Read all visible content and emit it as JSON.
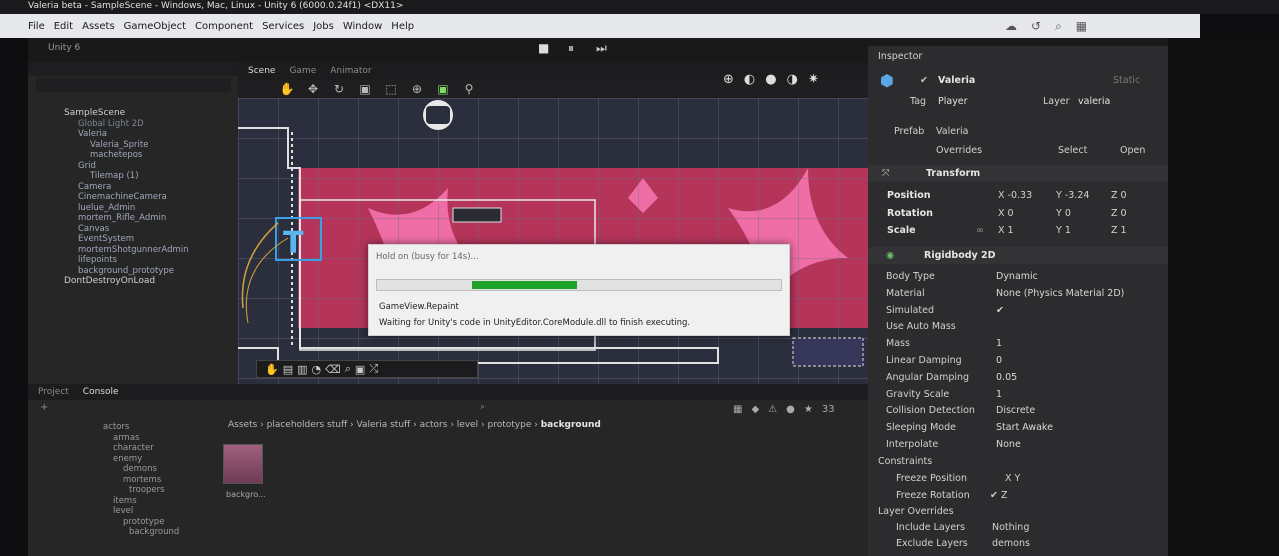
{
  "window": {
    "title": "Valeria beta - SampleScene - Windows, Mac, Linux - Unity 6 (6000.0.24f1) <DX11>"
  },
  "menu": [
    "File",
    "Edit",
    "Assets",
    "GameObject",
    "Component",
    "Services",
    "Jobs",
    "Window",
    "Help"
  ],
  "toolbar": {
    "account": "Unity 6",
    "play": "▶",
    "pause": "⏸",
    "step": "⏭"
  },
  "hierarchy": {
    "items": [
      {
        "label": "SampleScene",
        "kind": "scene"
      },
      {
        "label": "Global Light 2D",
        "kind": "dim"
      },
      {
        "label": "Valeria",
        "kind": "item"
      },
      {
        "label": "Valeria_Sprite",
        "kind": "item"
      },
      {
        "label": "machetepos",
        "kind": "item"
      },
      {
        "label": "Grid",
        "kind": "item"
      },
      {
        "label": "Tilemap (1)",
        "kind": "item"
      },
      {
        "label": "Camera",
        "kind": "item"
      },
      {
        "label": "CinemachineCamera",
        "kind": "item"
      },
      {
        "label": "luelue_Admin",
        "kind": "item"
      },
      {
        "label": "mortem_Rifle_Admin",
        "kind": "item"
      },
      {
        "label": "Canvas",
        "kind": "item"
      },
      {
        "label": "EventSystem",
        "kind": "item"
      },
      {
        "label": "mortemShotgunnerAdmin",
        "kind": "item"
      },
      {
        "label": "lifepoints",
        "kind": "item"
      },
      {
        "label": "background_prototype",
        "kind": "item"
      },
      {
        "label": "DontDestroyOnLoad",
        "kind": "scene"
      }
    ]
  },
  "scene_tabs": [
    "Scene",
    "Game",
    "Animator"
  ],
  "progress_dialog": {
    "title": "Hold on (busy for 14s)...",
    "step": "GameView.Repaint",
    "message": "Waiting for Unity's code in UnityEditor.CoreModule.dll to finish executing.",
    "progress": 0.26
  },
  "project": {
    "tabs": [
      "Project",
      "Console"
    ],
    "breadcrumb": [
      "Assets",
      "placeholders stuff",
      "Valeria stuff",
      "actors",
      "level",
      "prototype",
      "background"
    ],
    "tree": [
      "actors",
      "armas",
      "character",
      "enemy",
      "demons",
      "mortems",
      "troopers",
      "items",
      "level",
      "prototype",
      "background"
    ],
    "asset_label": "backgro...",
    "count": "33"
  },
  "inspector": {
    "title": "Inspector",
    "object_name": "Valeria",
    "static_label": "Static",
    "tag_label": "Tag",
    "tag": "Player",
    "layer_label": "Layer",
    "layer": "valeria",
    "prefab_label": "Prefab",
    "prefab": "Valeria",
    "overrides": "Overrides",
    "select": "Select",
    "open": "Open",
    "transform": {
      "header": "Transform",
      "position": {
        "label": "Position",
        "x": "X -0.33",
        "y": "Y -3.24",
        "z": "Z 0"
      },
      "rotation": {
        "label": "Rotation",
        "x": "X 0",
        "y": "Y 0",
        "z": "Z 0"
      },
      "scale": {
        "label": "Scale",
        "x": "X 1",
        "y": "Y 1",
        "z": "Z 1"
      }
    },
    "rigidbody": {
      "header": "Rigidbody 2D",
      "rows": [
        {
          "label": "Body Type",
          "value": "Dynamic"
        },
        {
          "label": "Material",
          "value": "None (Physics Material 2D)"
        },
        {
          "label": "Simulated",
          "value": "✔"
        },
        {
          "label": "Use Auto Mass",
          "value": ""
        },
        {
          "label": "Mass",
          "value": "1"
        },
        {
          "label": "Linear Damping",
          "value": "0"
        },
        {
          "label": "Angular Damping",
          "value": "0.05"
        },
        {
          "label": "Gravity Scale",
          "value": "1"
        },
        {
          "label": "Collision Detection",
          "value": "Discrete"
        },
        {
          "label": "Sleeping Mode",
          "value": "Start Awake"
        },
        {
          "label": "Interpolate",
          "value": "None"
        }
      ],
      "constraints": "Constraints",
      "freeze_position": {
        "label": "Freeze Position",
        "value": "X   Y"
      },
      "freeze_rotation": {
        "label": "Freeze Rotation",
        "value": "✔ Z"
      },
      "layer_overrides": "Layer Overrides",
      "include_layers": {
        "label": "Include Layers",
        "value": "Nothing"
      },
      "exclude_layers": {
        "label": "Exclude Layers",
        "value": "demons"
      }
    }
  },
  "colors": {
    "accent": "#1fa22a",
    "panel": "#2c2c2e",
    "scene_pink": "#b5345a"
  }
}
